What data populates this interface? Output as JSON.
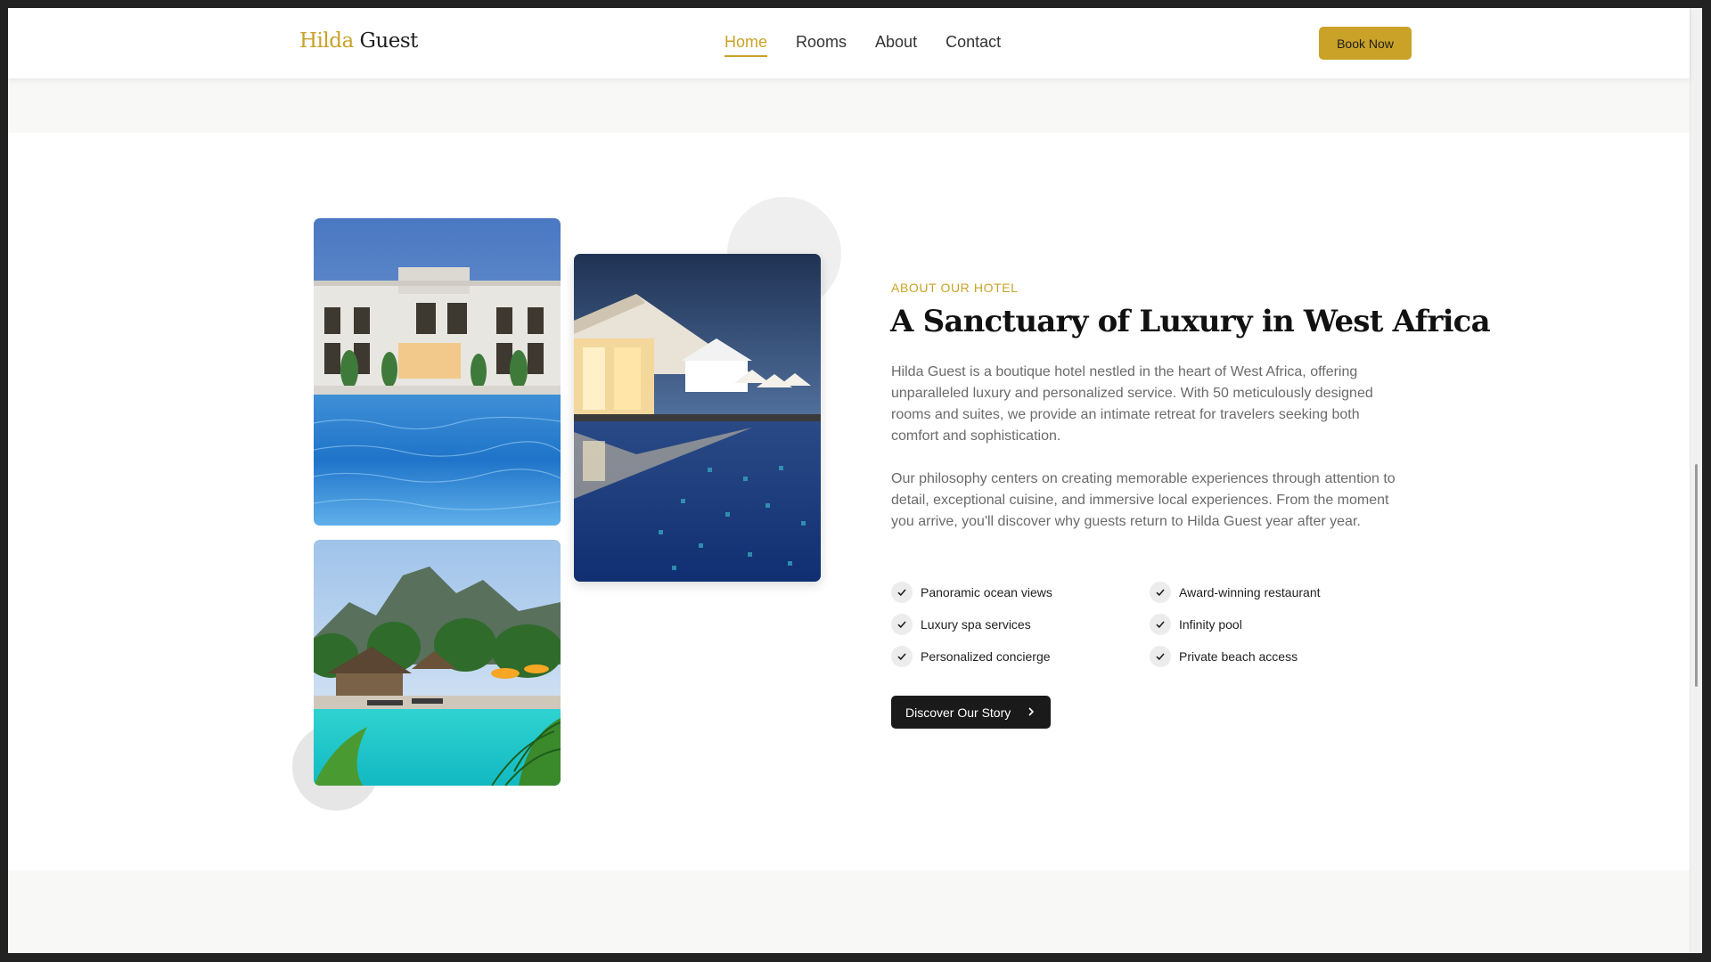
{
  "header": {
    "logo_first": "Hilda",
    "logo_second": "Guest",
    "nav": [
      {
        "label": "Home",
        "active": true
      },
      {
        "label": "Rooms"
      },
      {
        "label": "About"
      },
      {
        "label": "Contact"
      }
    ],
    "cta_label": "Book Now"
  },
  "about": {
    "eyebrow": "ABOUT OUR HOTEL",
    "heading": "A Sanctuary of Luxury in West Africa",
    "paragraphs": [
      "Hilda Guest is a boutique hotel nestled in the heart of West Africa, offering unparalleled luxury and personalized service. With 50 meticulously designed rooms and suites, we provide an intimate retreat for travelers seeking both comfort and sophistication.",
      "Our philosophy centers on creating memorable experiences through attention to detail, exceptional cuisine, and immersive local experiences. From the moment you arrive, you'll discover why guests return to Hilda Guest year after year."
    ],
    "features": [
      "Panoramic ocean views",
      "Award-winning restaurant",
      "Luxury spa services",
      "Infinity pool",
      "Personalized concierge",
      "Private beach access"
    ],
    "button_label": "Discover Our Story",
    "button_icon": "chevron-right-icon",
    "feature_icon": "check-icon"
  },
  "theme": {
    "accent": "#c9a227",
    "dark": "#1a1a1a",
    "muted_text": "#6b6b6b",
    "band": "#f8f8f7"
  }
}
